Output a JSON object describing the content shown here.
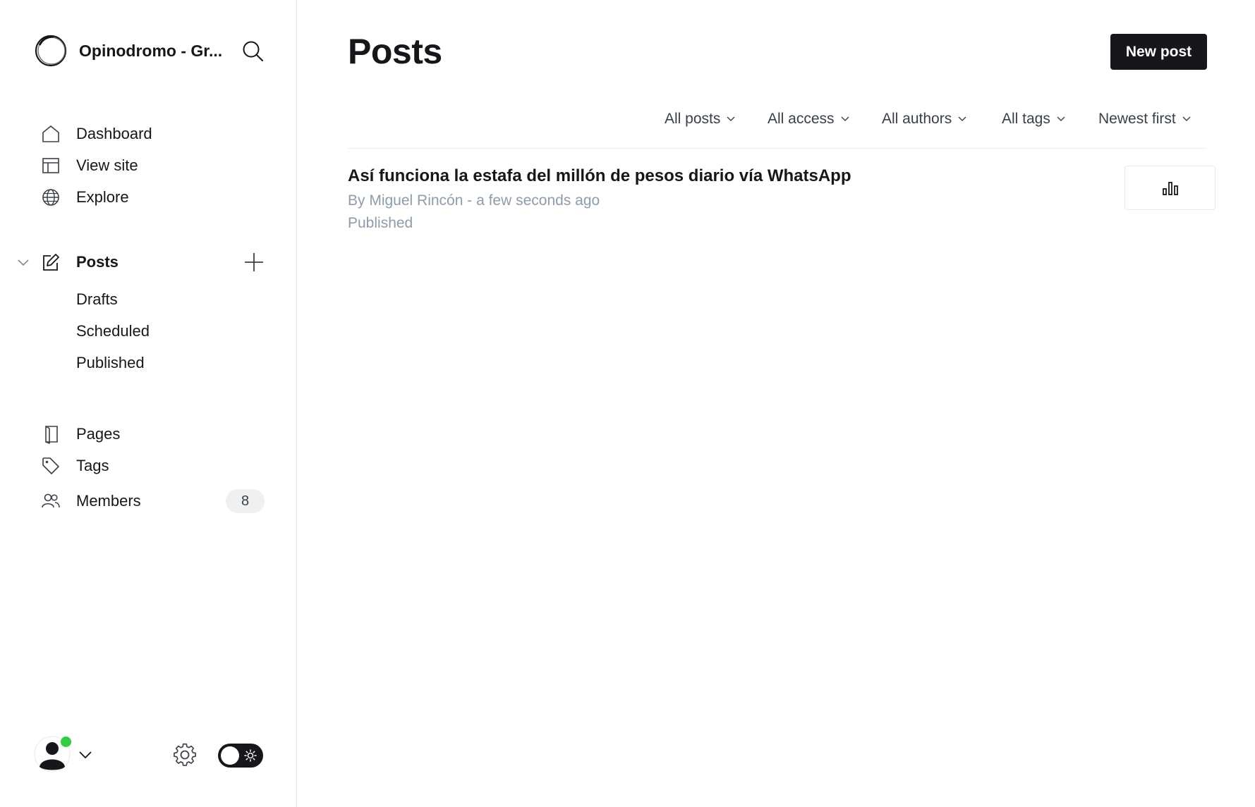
{
  "sidebar": {
    "site_title": "Opinodromo - Gr...",
    "nav": {
      "dashboard": "Dashboard",
      "view_site": "View site",
      "explore": "Explore",
      "posts": "Posts",
      "drafts": "Drafts",
      "scheduled": "Scheduled",
      "published": "Published",
      "pages": "Pages",
      "tags": "Tags",
      "members": "Members"
    },
    "members_count": "8"
  },
  "header": {
    "title": "Posts",
    "new_post_label": "New post"
  },
  "filters": {
    "type": "All posts",
    "access": "All access",
    "authors": "All authors",
    "tags": "All tags",
    "order": "Newest first"
  },
  "posts": [
    {
      "title": "Así funciona la estafa del millón de pesos diario vía WhatsApp",
      "meta": "By Miguel Rincón - a few seconds ago",
      "status": "Published"
    }
  ],
  "colors": {
    "primary": "#15171a",
    "muted": "#8e9cac",
    "online": "#30cf43"
  },
  "icons": [
    "search-icon",
    "home-icon",
    "layout-icon",
    "globe-icon",
    "edit-icon",
    "plus-icon",
    "page-icon",
    "tag-icon",
    "members-icon",
    "gear-icon",
    "sun-icon",
    "bar-chart-icon",
    "chevron-down-icon"
  ]
}
